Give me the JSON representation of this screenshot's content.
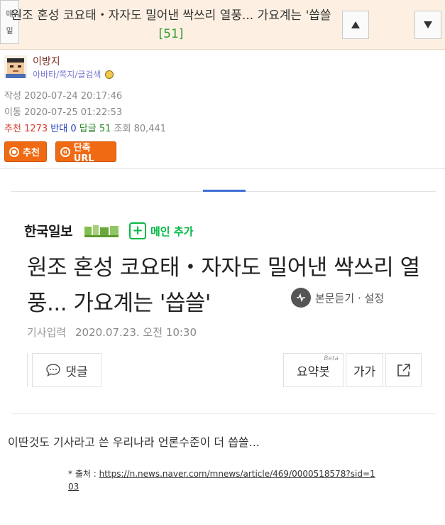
{
  "header": {
    "title_text": "원조 혼성 코요태・자자도 밀어낸 싹쓰리 열풍... 가요계는 '씁쓸",
    "comment_count": "[51]",
    "side_button_top": "매",
    "side_button_bottom": "밑",
    "up_icon": "triangle-up-icon",
    "down_icon": "triangle-down-icon"
  },
  "author": {
    "name": "이방지",
    "links": "아바타/쪽지/글검색",
    "icon": "smiley-icon"
  },
  "meta": {
    "written_label": "작성",
    "written": "2020-07-24 20:17:46",
    "moved_label": "이동",
    "moved": "2020-07-25 01:22:53",
    "recommend_label": "추천",
    "recommend": "1273",
    "oppose_label": "반대",
    "oppose": "0",
    "reply_label": "답글",
    "reply": "51",
    "views_label": "조회",
    "views": "80,441"
  },
  "buttons": {
    "recommend": "추천",
    "short_url": "단축URL"
  },
  "article": {
    "brand": "한국일보",
    "add_main": "메인 추가",
    "headline": "원조 혼성 코요태・자자도 밀어낸 싹쓰리 열풍... 가요계는 '씁쓸'",
    "listen": "본문듣기 · 설정",
    "date_label": "기사입력",
    "date": "2020.07.23. 오전 10:30",
    "comment_btn": "댓글",
    "summary_btn": "요약봇",
    "beta": "Beta",
    "font_btn": "가가",
    "share_icon": "share-icon"
  },
  "post": {
    "body": "이딴것도 기사라고 쓴 우리나라 언론수준이 더 씁쓸...",
    "source_label": "* 출처 :",
    "source_url": "https://n.news.naver.com/mnews/article/469/0000518578?sid=103"
  },
  "colors": {
    "header_bg": "#fdf0e2",
    "accent_orange": "#ef6a12",
    "recommend_red": "#d63b2f",
    "oppose_blue": "#1f3fb8",
    "reply_green": "#2e8b2e",
    "naver_green": "#05b946"
  }
}
